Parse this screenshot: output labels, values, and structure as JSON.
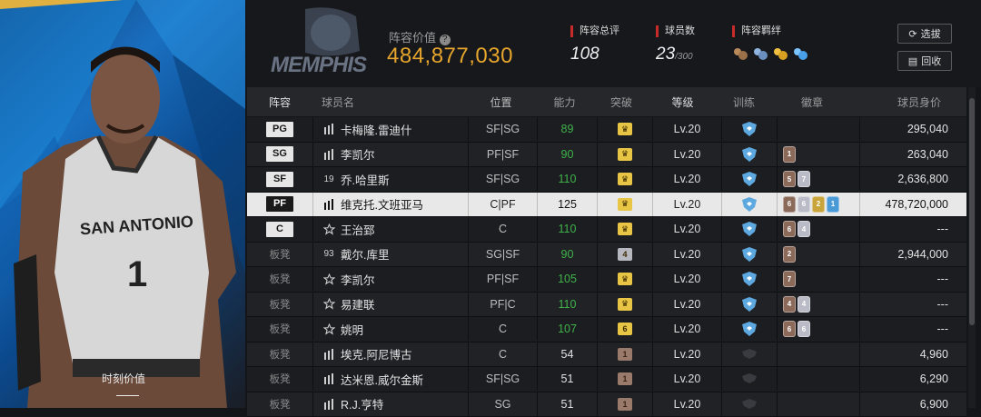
{
  "card": {
    "moment_label": "时刻价值",
    "moment_value": "——",
    "jersey_text": "SAN ANTONIO",
    "jersey_number": "1"
  },
  "header": {
    "team_logo_text": "MEMPHIS",
    "lineup_value_label": "阵容价值",
    "lineup_value": "484,877,030",
    "rating_label": "阵容总评",
    "rating_value": "108",
    "players_label": "球员数",
    "players_count": "23",
    "players_max": "/300",
    "bonds_label": "阵容羁绊",
    "select_button": "选拔",
    "recycle_button": "回收"
  },
  "columns": [
    "阵容",
    "球员名",
    "位置",
    "能力",
    "突破",
    "等级",
    "训练",
    "徽章",
    "球员身价"
  ],
  "colors": {
    "gold": "#e6a52c",
    "green": "#3fb34a",
    "accent_red": "#c92a2a",
    "break_gold": "#e8c544",
    "break_bronze": "#9a7a6a",
    "badge_bronze": "#8b6a5a",
    "badge_silver": "#b9bcc6",
    "badge_gold": "#c9a43a",
    "badge_blue": "#4a9ad8"
  },
  "rows": [
    {
      "slot": "PG",
      "bench": false,
      "icon": "bars-icon",
      "name": "卡梅隆.雷迪什",
      "role": "SF|SG",
      "ability": "89",
      "abilityGreen": true,
      "break": "crown",
      "level": "Lv.20",
      "train": "active",
      "badges": [],
      "price": "295,040"
    },
    {
      "slot": "SG",
      "bench": false,
      "icon": "bars-icon",
      "name": "李凯尔",
      "role": "PF|SF",
      "ability": "90",
      "abilityGreen": true,
      "break": "crown",
      "level": "Lv.20",
      "train": "active",
      "badges": [
        [
          "1",
          "bronze"
        ]
      ],
      "price": "263,040"
    },
    {
      "slot": "SF",
      "bench": false,
      "icon": "19",
      "name": "乔.哈里斯",
      "role": "SF|SG",
      "ability": "110",
      "abilityGreen": true,
      "break": "crown",
      "level": "Lv.20",
      "train": "active",
      "badges": [
        [
          "5",
          "bronze"
        ],
        [
          "7",
          "silver"
        ]
      ],
      "price": "2,636,800"
    },
    {
      "slot": "PF",
      "bench": false,
      "selected": true,
      "icon": "bars-icon",
      "name": "维克托.文班亚马",
      "role": "C|PF",
      "ability": "125",
      "abilityGreen": false,
      "break": "crown",
      "level": "Lv.20",
      "train": "active",
      "badges": [
        [
          "6",
          "bronze"
        ],
        [
          "6",
          "silver"
        ],
        [
          "2",
          "gold"
        ],
        [
          "1",
          "blue"
        ]
      ],
      "price": "478,720,000"
    },
    {
      "slot": "C",
      "bench": false,
      "icon": "star-icon",
      "name": "王治郅",
      "role": "C",
      "ability": "110",
      "abilityGreen": true,
      "break": "crown",
      "level": "Lv.20",
      "train": "active",
      "badges": [
        [
          "6",
          "bronze"
        ],
        [
          "4",
          "silver"
        ]
      ],
      "price": "---"
    },
    {
      "slot": "板凳",
      "bench": true,
      "icon": "93",
      "name": "戴尔.库里",
      "role": "SG|SF",
      "ability": "90",
      "abilityGreen": true,
      "break": "4",
      "level": "Lv.20",
      "train": "active",
      "badges": [
        [
          "2",
          "bronze"
        ]
      ],
      "price": "2,944,000"
    },
    {
      "slot": "板凳",
      "bench": true,
      "icon": "star-icon",
      "name": "李凯尔",
      "role": "PF|SF",
      "ability": "105",
      "abilityGreen": true,
      "break": "crown",
      "level": "Lv.20",
      "train": "active",
      "badges": [
        [
          "7",
          "bronze"
        ]
      ],
      "price": "---"
    },
    {
      "slot": "板凳",
      "bench": true,
      "icon": "star-icon",
      "name": "易建联",
      "role": "PF|C",
      "ability": "110",
      "abilityGreen": true,
      "break": "crown",
      "level": "Lv.20",
      "train": "active",
      "badges": [
        [
          "4",
          "bronze"
        ],
        [
          "4",
          "silver"
        ]
      ],
      "price": "---"
    },
    {
      "slot": "板凳",
      "bench": true,
      "icon": "star-icon",
      "name": "姚明",
      "role": "C",
      "ability": "107",
      "abilityGreen": true,
      "break": "6",
      "level": "Lv.20",
      "train": "active",
      "badges": [
        [
          "6",
          "bronze"
        ],
        [
          "6",
          "silver"
        ]
      ],
      "price": "---"
    },
    {
      "slot": "板凳",
      "bench": true,
      "icon": "bars-icon",
      "name": "埃克.阿尼博古",
      "role": "C",
      "ability": "54",
      "abilityGreen": false,
      "break": "1",
      "level": "Lv.20",
      "train": "inactive",
      "badges": [],
      "price": "4,960"
    },
    {
      "slot": "板凳",
      "bench": true,
      "icon": "bars-icon",
      "name": "达米恩.威尔金斯",
      "role": "SF|SG",
      "ability": "51",
      "abilityGreen": false,
      "break": "1",
      "level": "Lv.20",
      "train": "inactive",
      "badges": [],
      "price": "6,290"
    },
    {
      "slot": "板凳",
      "bench": true,
      "icon": "bars-icon",
      "name": "R.J.亨特",
      "role": "SG",
      "ability": "51",
      "abilityGreen": false,
      "break": "1",
      "level": "Lv.20",
      "train": "inactive",
      "badges": [],
      "price": "6,900"
    }
  ]
}
